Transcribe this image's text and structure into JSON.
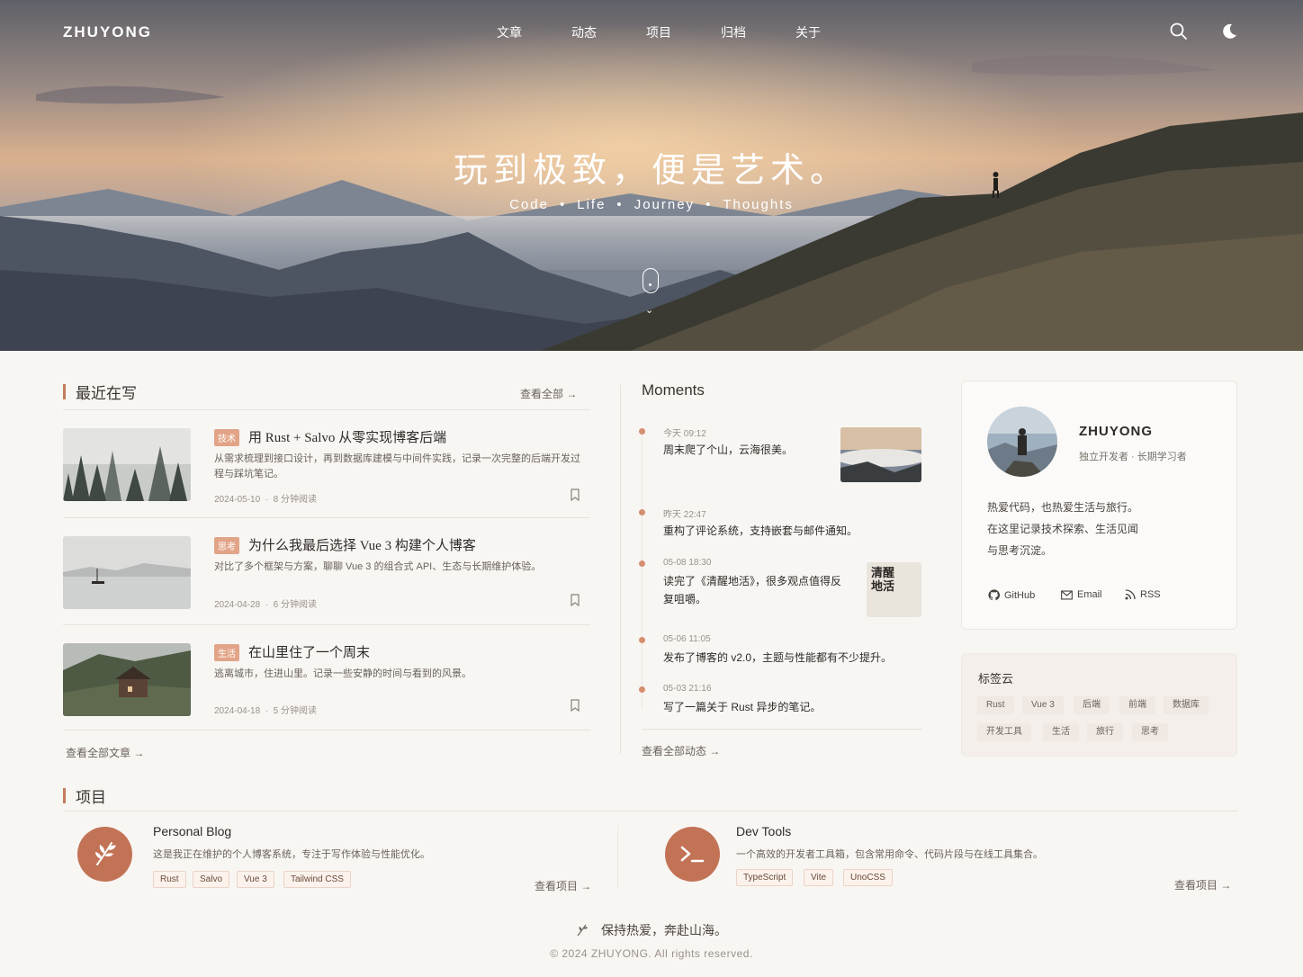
{
  "nav": {
    "brand": "ZHUYONG",
    "links": [
      "文章",
      "动态",
      "项目",
      "归档",
      "关于"
    ],
    "search_icon": "search-icon",
    "theme_icon": "moon-icon"
  },
  "hero": {
    "title": "玩到极致，便是艺术。",
    "subtitle": [
      "Code",
      "Life",
      "Journey",
      "Thoughts"
    ]
  },
  "posts": {
    "title": "最近在写",
    "view_all": "查看全部 →",
    "bottom_link": "查看全部文章 →",
    "items": [
      {
        "tag": "技术",
        "title": "用 Rust + Salvo 从零实现博客后端",
        "desc": "从需求梳理到接口设计，再到数据库建模与中间件实践，记录一次完整的后端开发过程与踩坑笔记。",
        "date": "2024-05-10",
        "read": "8 分钟阅读"
      },
      {
        "tag": "思考",
        "title": "为什么我最后选择 Vue 3 构建个人博客",
        "desc": "对比了多个框架与方案，聊聊 Vue 3 的组合式 API、生态与长期维护体验。",
        "date": "2024-04-28",
        "read": "6 分钟阅读"
      },
      {
        "tag": "生活",
        "title": "在山里住了一个周末",
        "desc": "逃离城市，住进山里。记录一些安静的时间与看到的风景。",
        "date": "2024-04-18",
        "read": "5 分钟阅读"
      }
    ]
  },
  "moments": {
    "title": "Moments",
    "bottom_link": "查看全部动态 →",
    "items": [
      {
        "time": "今天 09:12",
        "text": "周末爬了个山，云海很美。"
      },
      {
        "time": "昨天 22:47",
        "text": "重构了评论系统，支持嵌套与邮件通知。"
      },
      {
        "time": "05-08 18:30",
        "text": "读完了《清醒地活》，很多观点值得反复咀嚼。",
        "book": "清醒地活"
      },
      {
        "time": "05-06 11:05",
        "text": "发布了博客的 v2.0，主题与性能都有不少提升。"
      },
      {
        "time": "05-03 21:16",
        "text": "写了一篇关于 Rust 异步的笔记。"
      }
    ]
  },
  "profile": {
    "name": "ZHUYONG",
    "role": "独立开发者 · 长期学习者",
    "bio": [
      "热爱代码，也热爱生活与旅行。",
      "在这里记录技术探索、生活见闻",
      "与思考沉淀。"
    ],
    "links": [
      {
        "label": "GitHub",
        "icon": "github-icon"
      },
      {
        "label": "Email",
        "icon": "mail-icon"
      },
      {
        "label": "RSS",
        "icon": "rss-icon"
      }
    ]
  },
  "tags": {
    "title": "标签云",
    "items": [
      "Rust",
      "Vue 3",
      "后端",
      "前端",
      "数据库",
      "开发工具",
      "生活",
      "旅行",
      "思考"
    ]
  },
  "projects": {
    "title": "项目",
    "items": [
      {
        "name": "Personal Blog",
        "desc": "这是我正在维护的个人博客系统，专注于写作体验与性能优化。",
        "tags": [
          "Rust",
          "Salvo",
          "Vue 3",
          "Tailwind CSS"
        ],
        "link": "查看项目 →",
        "icon": "leaf-icon"
      },
      {
        "name": "Dev Tools",
        "desc": "一个高效的开发者工具箱，包含常用命令、代码片段与在线工具集合。",
        "tags": [
          "TypeScript",
          "Vite",
          "UnoCSS"
        ],
        "link": "查看项目 →",
        "icon": "terminal-icon"
      }
    ]
  },
  "footer": {
    "motto": "保持热爱，奔赴山海。",
    "copyright": "© 2024 ZHUYONG. All rights reserved."
  },
  "colors": {
    "accent": "#c47a5a",
    "background": "#f8f6f3",
    "text": "#3a3430"
  }
}
